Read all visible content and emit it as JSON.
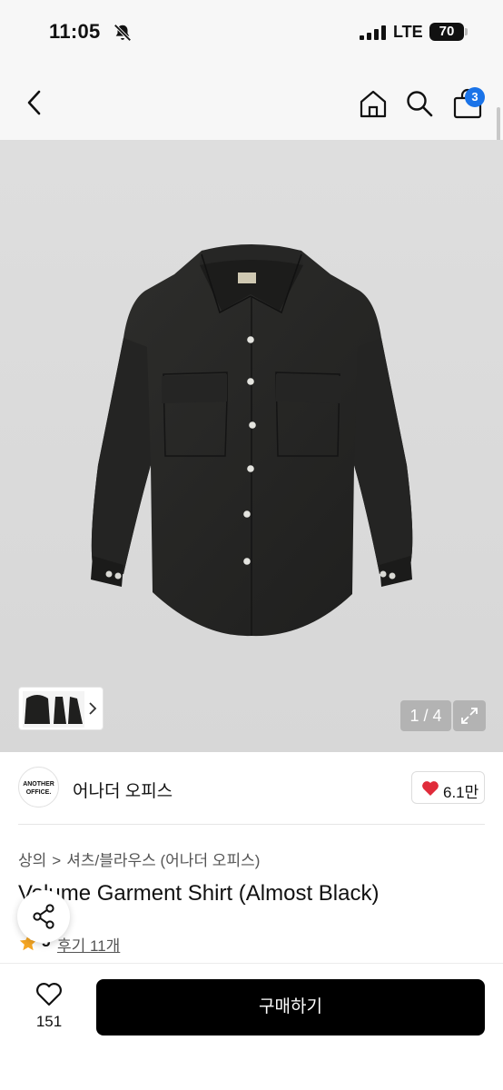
{
  "status_bar": {
    "time": "11:05",
    "network": "LTE",
    "battery": "70",
    "icons": [
      "bell-slash-icon",
      "signal-icon"
    ]
  },
  "header": {
    "icons": [
      "back-icon",
      "home-icon",
      "search-icon",
      "cart-icon"
    ],
    "cart_count": "3"
  },
  "gallery": {
    "counter": "1 / 4",
    "icons": [
      "expand-icon",
      "chevron-right-icon"
    ]
  },
  "brand": {
    "logo_text": "ANOTHER OFFICE.",
    "name": "어나더 오피스",
    "likes": "6.1만"
  },
  "breadcrumb": {
    "category": "상의",
    "subcategory": "셔츠/블라우스 (어나더 오피스)"
  },
  "product": {
    "title": "Volume Garment Shirt (Almost Black)",
    "rating": "5",
    "reviews": "후기 11개"
  },
  "bottom_bar": {
    "wish_count": "151",
    "buy_label": "구매하기"
  },
  "colors": {
    "accent_badge": "#1a73e8",
    "heart": "#e02b3a",
    "star": "#f5a623",
    "buy_button": "#000000"
  }
}
